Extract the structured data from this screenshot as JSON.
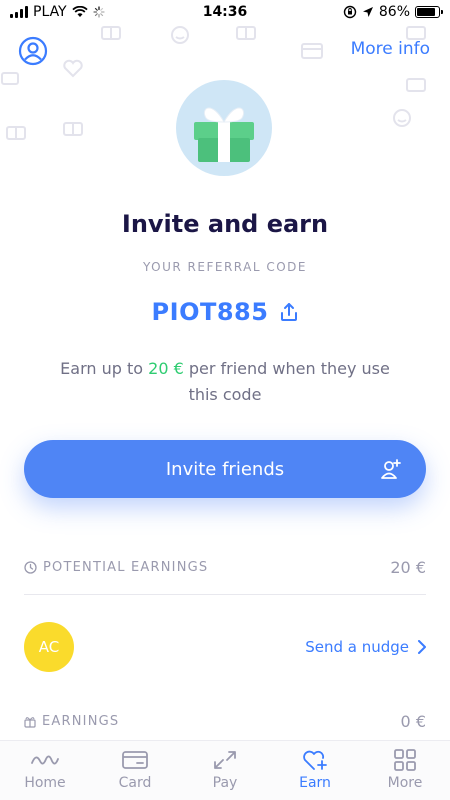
{
  "status_bar": {
    "carrier": "PLAY",
    "time": "14:36",
    "battery_percent": "86%",
    "battery_level": 0.86
  },
  "header": {
    "more_info_label": "More info",
    "profile_icon": "person-circle-icon"
  },
  "hero": {
    "title": "Invite and earn",
    "referral_caption": "YOUR REFERRAL CODE",
    "referral_code": "PIOT885",
    "earn_prefix": "Earn up to ",
    "earn_amount": "20 €",
    "earn_suffix": " per friend when they use this code",
    "invite_button_label": "Invite friends",
    "gift_icon": "gift-icon",
    "share_icon": "share-icon"
  },
  "potential_earnings": {
    "label": "POTENTIAL EARNINGS",
    "value": "20 €",
    "icon": "clock-icon"
  },
  "friend": {
    "initials": "AC",
    "action_label": "Send a nudge",
    "avatar_color": "#fadb2c"
  },
  "earnings": {
    "label": "EARNINGS",
    "value": "0 €",
    "icon": "gift-small-icon"
  },
  "tab_bar": {
    "tabs": [
      {
        "label": "Home",
        "icon": "home-wave-icon",
        "active": false
      },
      {
        "label": "Card",
        "icon": "card-icon",
        "active": false
      },
      {
        "label": "Pay",
        "icon": "transfer-arrows-icon",
        "active": false
      },
      {
        "label": "Earn",
        "icon": "heart-plus-icon",
        "active": true
      },
      {
        "label": "More",
        "icon": "grid-icon",
        "active": false
      }
    ]
  },
  "colors": {
    "accent": "#3b7cff",
    "button": "#4f85f5",
    "earn_amount": "#2ecc71",
    "title": "#1b1646",
    "muted": "#9a9aae"
  }
}
